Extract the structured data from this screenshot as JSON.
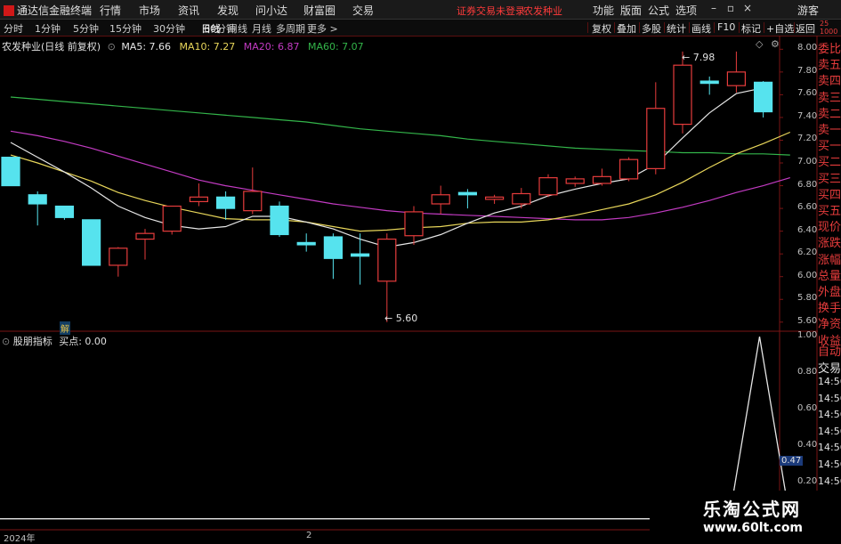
{
  "app": {
    "title": "通达信金融终端"
  },
  "menu": [
    "行情",
    "市场",
    "资讯",
    "发现",
    "问小达",
    "财富圈",
    "交易"
  ],
  "notice": {
    "login": "证券交易未登录",
    "stock": "农发种业"
  },
  "right_menu": [
    "功能",
    "版面",
    "公式",
    "选项"
  ],
  "guest": "游客",
  "window_controls": {
    "minimize": "–",
    "restore": "▫",
    "close": "×"
  },
  "periods": [
    "分时",
    "1分钟",
    "5分钟",
    "15分钟",
    "30分钟",
    "60分钟",
    "日线",
    "周线",
    "月线",
    "多周期",
    "更多 >"
  ],
  "active_period": "日线",
  "toolbar": [
    "复权",
    "叠加",
    "多股",
    "统计",
    "画线",
    "F10",
    "标记",
    "+自选",
    "返回"
  ],
  "main_legend": {
    "name": "农发种业(日线 前复权)",
    "ma5": "MA5: 7.66",
    "ma10": "MA10: 7.27",
    "ma20": "MA20: 6.87",
    "ma60": "MA60: 7.07"
  },
  "colors": {
    "up": "#e63c3c",
    "down": "#56e3ee",
    "ma5": "#e6e6e6",
    "ma10": "#e8d65a",
    "ma20": "#c33bc3",
    "ma60": "#33b54a",
    "frame": "#7a1414"
  },
  "annotations": {
    "high": "7.98",
    "low": "5.60",
    "marker": "解"
  },
  "sub_legend": {
    "name": "股朋指标",
    "value": "买点: 0.00"
  },
  "sub_highlight": "0.47",
  "x_axis": {
    "left": "2024年",
    "mid": "2"
  },
  "side_labels": [
    "委比",
    "卖五",
    "卖四",
    "卖三",
    "卖二",
    "卖一",
    "买一",
    "买二",
    "买三",
    "买四",
    "买五",
    "现价",
    "涨跌",
    "涨幅",
    "总量",
    "外盘",
    "换手",
    "净资",
    "收益"
  ],
  "sub_side": {
    "auto": "自动",
    "trade": "交易",
    "times": [
      "14:56",
      "14:56",
      "14:56",
      "14:56",
      "14:56",
      "14:56",
      "14:56",
      "14:56"
    ]
  },
  "top_right_scale": [
    "25",
    "1000"
  ],
  "watermark": {
    "name": "乐淘公式网",
    "url": "www.60lt.com"
  },
  "chart_data": [
    {
      "type": "candlestick",
      "y_ticks": [
        8.0,
        7.8,
        7.6,
        7.4,
        7.2,
        7.0,
        6.8,
        6.6,
        6.4,
        6.2,
        6.0,
        5.8,
        5.6
      ],
      "ylim": [
        5.52,
        8.12
      ],
      "candles": [
        {
          "o": 7.05,
          "c": 6.8,
          "h": 7.05,
          "l": 6.8
        },
        {
          "o": 6.72,
          "c": 6.64,
          "h": 6.75,
          "l": 6.45
        },
        {
          "o": 6.62,
          "c": 6.52,
          "h": 6.62,
          "l": 6.5
        },
        {
          "o": 6.5,
          "c": 6.1,
          "h": 6.5,
          "l": 6.1
        },
        {
          "o": 6.1,
          "c": 6.25,
          "h": 6.26,
          "l": 6.0
        },
        {
          "o": 6.33,
          "c": 6.38,
          "h": 6.42,
          "l": 6.15
        },
        {
          "o": 6.4,
          "c": 6.62,
          "h": 6.62,
          "l": 6.37
        },
        {
          "o": 6.66,
          "c": 6.7,
          "h": 6.82,
          "l": 6.62
        },
        {
          "o": 6.7,
          "c": 6.6,
          "h": 6.75,
          "l": 6.5
        },
        {
          "o": 6.58,
          "c": 6.75,
          "h": 6.96,
          "l": 6.55
        },
        {
          "o": 6.62,
          "c": 6.37,
          "h": 6.66,
          "l": 6.35
        },
        {
          "o": 6.3,
          "c": 6.28,
          "h": 6.38,
          "l": 6.22
        },
        {
          "o": 6.35,
          "c": 6.16,
          "h": 6.38,
          "l": 5.98
        },
        {
          "o": 6.2,
          "c": 6.18,
          "h": 6.38,
          "l": 5.93
        },
        {
          "o": 5.96,
          "c": 6.33,
          "h": 6.38,
          "l": 5.6
        },
        {
          "o": 6.36,
          "c": 6.57,
          "h": 6.62,
          "l": 6.28
        },
        {
          "o": 6.64,
          "c": 6.72,
          "h": 6.8,
          "l": 6.55
        },
        {
          "o": 6.74,
          "c": 6.72,
          "h": 6.77,
          "l": 6.6
        },
        {
          "o": 6.68,
          "c": 6.7,
          "h": 6.72,
          "l": 6.64
        },
        {
          "o": 6.64,
          "c": 6.73,
          "h": 6.78,
          "l": 6.6
        },
        {
          "o": 6.72,
          "c": 6.87,
          "h": 6.9,
          "l": 6.7
        },
        {
          "o": 6.82,
          "c": 6.86,
          "h": 6.88,
          "l": 6.79
        },
        {
          "o": 6.82,
          "c": 6.88,
          "h": 6.95,
          "l": 6.8
        },
        {
          "o": 6.86,
          "c": 7.03,
          "h": 7.05,
          "l": 6.84
        },
        {
          "o": 6.95,
          "c": 7.48,
          "h": 7.71,
          "l": 6.9
        },
        {
          "o": 7.34,
          "c": 7.86,
          "h": 7.98,
          "l": 7.26
        },
        {
          "o": 7.72,
          "c": 7.7,
          "h": 7.76,
          "l": 7.6
        },
        {
          "o": 7.68,
          "c": 7.8,
          "h": 7.98,
          "l": 7.62
        },
        {
          "o": 7.71,
          "c": 7.45,
          "h": 7.72,
          "l": 7.4
        }
      ],
      "ma5": [
        7.18,
        7.05,
        6.92,
        6.78,
        6.62,
        6.52,
        6.45,
        6.42,
        6.44,
        6.53,
        6.53,
        6.48,
        6.42,
        6.33,
        6.26,
        6.3,
        6.37,
        6.47,
        6.56,
        6.62,
        6.71,
        6.77,
        6.82,
        6.86,
        6.99,
        7.22,
        7.44,
        7.61,
        7.66
      ],
      "ma10": [
        7.07,
        7.0,
        6.92,
        6.84,
        6.74,
        6.67,
        6.61,
        6.56,
        6.51,
        6.5,
        6.5,
        6.48,
        6.44,
        6.4,
        6.41,
        6.43,
        6.44,
        6.47,
        6.48,
        6.48,
        6.5,
        6.54,
        6.59,
        6.64,
        6.72,
        6.83,
        6.96,
        7.08,
        7.17,
        7.27
      ],
      "ma20": [
        7.28,
        7.24,
        7.19,
        7.13,
        7.06,
        6.99,
        6.92,
        6.85,
        6.8,
        6.76,
        6.72,
        6.68,
        6.64,
        6.61,
        6.58,
        6.56,
        6.55,
        6.54,
        6.53,
        6.52,
        6.51,
        6.5,
        6.5,
        6.52,
        6.56,
        6.61,
        6.67,
        6.74,
        6.8,
        6.87
      ],
      "ma60": [
        7.58,
        7.56,
        7.54,
        7.52,
        7.5,
        7.48,
        7.46,
        7.44,
        7.42,
        7.4,
        7.38,
        7.36,
        7.33,
        7.3,
        7.28,
        7.26,
        7.24,
        7.21,
        7.19,
        7.17,
        7.15,
        7.13,
        7.12,
        7.11,
        7.1,
        7.09,
        7.09,
        7.08,
        7.08,
        7.07
      ]
    },
    {
      "type": "line",
      "title": "股朋指标",
      "y_ticks": [
        1.0,
        0.8,
        0.6,
        0.4,
        0.2
      ],
      "ylim": [
        -0.06,
        1.03
      ],
      "values": [
        0,
        0,
        0,
        0,
        0,
        0,
        0,
        0,
        0,
        0,
        0,
        0,
        0,
        0,
        0,
        0,
        0,
        0,
        0,
        0,
        0,
        0,
        0,
        0,
        0,
        1.0,
        0
      ]
    }
  ]
}
